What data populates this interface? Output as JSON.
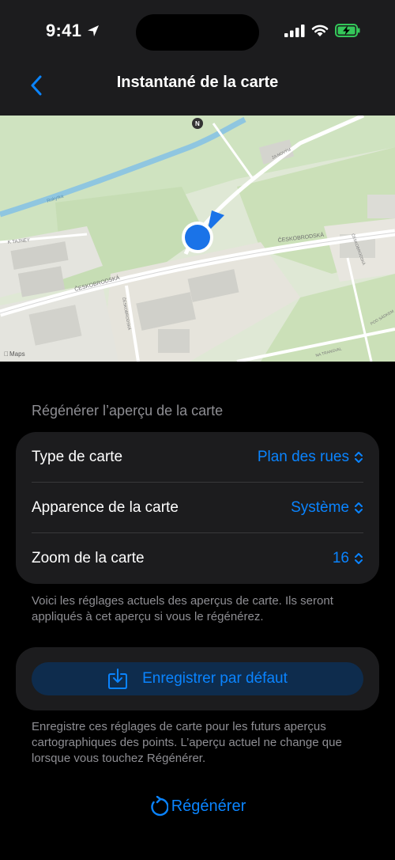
{
  "status_bar": {
    "time": "9:41"
  },
  "nav": {
    "title": "Instantané de la carte"
  },
  "map": {
    "attribution": "Maps",
    "streets": [
      "ČESKOBRODSKÁ",
      "ČESKOBRODSKÁ",
      "K TAJNEY",
      "Rokytka",
      "ZA NOVÝM",
      "ČESKOBRODSKÁ",
      "ČESKOBRODSKÁ",
      "POD SÁDKEM",
      "NA TRANSVAL"
    ]
  },
  "settings": {
    "header": "Régénérer l’aperçu de la carte",
    "rows": [
      {
        "label": "Type de carte",
        "value": "Plan des rues"
      },
      {
        "label": "Apparence de la carte",
        "value": "Système"
      },
      {
        "label": "Zoom de la carte",
        "value": "16"
      }
    ],
    "footnote": "Voici les réglages actuels des aperçus de carte. Ils seront appliqués à cet aperçu si vous le régénérez."
  },
  "save": {
    "label": "Enregistrer par défaut",
    "footnote": "Enregistre ces réglages de carte pour les futurs aperçus cartographiques des points. L’aperçu actuel ne change que lorsque vous touchez Régénérer."
  },
  "regenerate": {
    "label": "Régénérer"
  },
  "colors": {
    "accent": "#0a84ff",
    "background": "#000000",
    "card": "#1c1c1e",
    "secondary_text": "#8e8e93"
  }
}
